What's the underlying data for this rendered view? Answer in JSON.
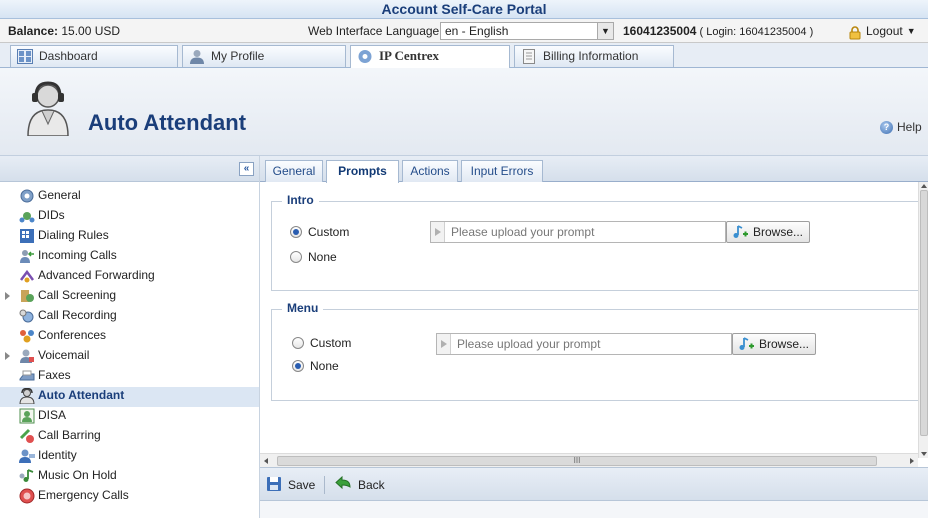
{
  "portal": {
    "title": "Account Self-Care Portal"
  },
  "infobar": {
    "balance_label": "Balance:",
    "balance_value": "15.00 USD",
    "language_label": "Web Interface Language:",
    "language_value": "en - English",
    "account_id": "16041235004",
    "login_text": "( Login: 16041235004 )",
    "logout_label": "Logout"
  },
  "top_tabs": [
    {
      "label": "Dashboard",
      "icon": "dashboard-icon"
    },
    {
      "label": "My Profile",
      "icon": "profile-icon"
    },
    {
      "label": "IP Centrex",
      "icon": "ip-centrex-icon",
      "active": true
    },
    {
      "label": "Billing Information",
      "icon": "billing-icon"
    }
  ],
  "page": {
    "title": "Auto Attendant",
    "help_label": "Help"
  },
  "sidebar": {
    "collapse_label": "«",
    "items": [
      {
        "label": "General",
        "icon": "gear-icon"
      },
      {
        "label": "DIDs",
        "icon": "dids-icon"
      },
      {
        "label": "Dialing Rules",
        "icon": "dialing-rules-icon"
      },
      {
        "label": "Incoming Calls",
        "icon": "incoming-calls-icon"
      },
      {
        "label": "Advanced Forwarding",
        "icon": "advanced-forwarding-icon"
      },
      {
        "label": "Call Screening",
        "icon": "call-screening-icon",
        "expandable": true
      },
      {
        "label": "Call Recording",
        "icon": "call-recording-icon"
      },
      {
        "label": "Conferences",
        "icon": "conferences-icon"
      },
      {
        "label": "Voicemail",
        "icon": "voicemail-icon",
        "expandable": true
      },
      {
        "label": "Faxes",
        "icon": "fax-icon"
      },
      {
        "label": "Auto Attendant",
        "icon": "auto-attendant-icon",
        "active": true
      },
      {
        "label": "DISA",
        "icon": "disa-icon"
      },
      {
        "label": "Call Barring",
        "icon": "call-barring-icon"
      },
      {
        "label": "Identity",
        "icon": "identity-icon"
      },
      {
        "label": "Music On Hold",
        "icon": "music-on-hold-icon"
      },
      {
        "label": "Emergency Calls",
        "icon": "emergency-calls-icon"
      }
    ]
  },
  "sub_tabs": [
    {
      "label": "General"
    },
    {
      "label": "Prompts",
      "active": true
    },
    {
      "label": "Actions"
    },
    {
      "label": "Input Errors"
    }
  ],
  "intro": {
    "legend": "Intro",
    "custom_label": "Custom",
    "none_label": "None",
    "selected": "Custom",
    "upload_placeholder": "Please upload your prompt",
    "browse_label": "Browse..."
  },
  "menu": {
    "legend": "Menu",
    "custom_label": "Custom",
    "none_label": "None",
    "selected": "None",
    "upload_placeholder": "Please upload your prompt",
    "browse_label": "Browse..."
  },
  "actions": {
    "save_label": "Save",
    "back_label": "Back"
  },
  "scrollbar_grip": "III",
  "colors": {
    "brand": "#1a3e7a",
    "accent": "#2a5db0",
    "active_item_bg": "#dbe6f3"
  }
}
